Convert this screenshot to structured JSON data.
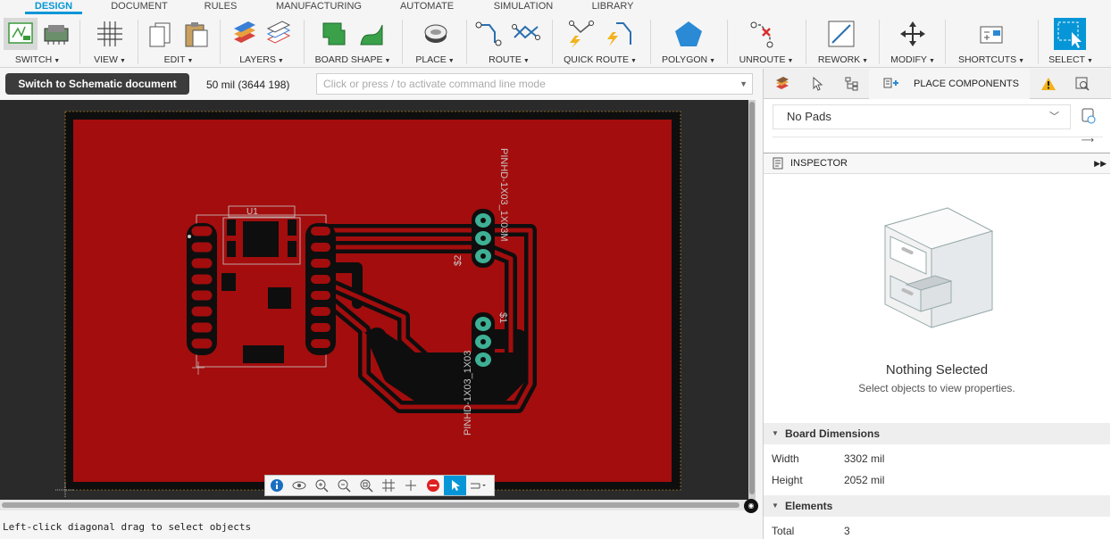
{
  "menu": {
    "tabs": [
      "DESIGN",
      "DOCUMENT",
      "RULES",
      "MANUFACTURING",
      "AUTOMATE",
      "SIMULATION",
      "LIBRARY"
    ],
    "active": "DESIGN"
  },
  "toolbar": {
    "switch": "SWITCH",
    "view": "VIEW",
    "edit": "EDIT",
    "layers": "LAYERS",
    "board_shape": "BOARD SHAPE",
    "place": "PLACE",
    "route": "ROUTE",
    "quick_route": "QUICK ROUTE",
    "polygon": "POLYGON",
    "unroute": "UNROUTE",
    "rework": "REWORK",
    "modify": "MODIFY",
    "shortcuts": "SHORTCUTS",
    "select": "SELECT"
  },
  "command": {
    "switch_button": "Switch to Schematic document",
    "coordinates": "50 mil (3644 198)",
    "input_placeholder": "Click or press / to activate command line mode"
  },
  "board": {
    "colors": {
      "background": "#2a2a2a",
      "copper": "#a30d0d",
      "trace": "#0e0e0e",
      "pad": "#3db095",
      "silk": "#c8c8c8"
    },
    "labels": {
      "u1": "U1",
      "j1_name": "$1",
      "j1_value": "PINHD-1X03_1X03",
      "j2_name": "$2",
      "j2_value": "PINHD-1X03_1X03M"
    }
  },
  "canvas_toolbar": {
    "items": [
      "info-icon",
      "eye-icon",
      "zoom-in-icon",
      "zoom-out-icon",
      "zoom-fit-icon",
      "grid-icon",
      "crosshair-icon",
      "stop-icon",
      "select-arrow-icon",
      "route-tool-icon"
    ]
  },
  "status": {
    "message": "Left-click diagonal drag to select objects"
  },
  "right_panel": {
    "place_components": "PLACE COMPONENTS",
    "filter_value": "No Pads",
    "inspector_title": "INSPECTOR",
    "nothing_selected": "Nothing Selected",
    "nothing_hint": "Select objects to view properties.",
    "board_dimensions": {
      "title": "Board Dimensions",
      "width_label": "Width",
      "width_value": "3302 mil",
      "height_label": "Height",
      "height_value": "2052 mil"
    },
    "elements": {
      "title": "Elements",
      "total_label": "Total",
      "total_value": "3"
    }
  }
}
